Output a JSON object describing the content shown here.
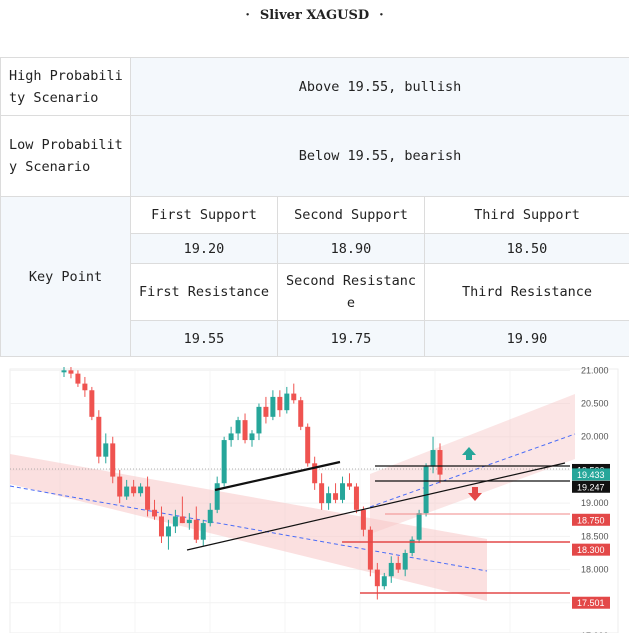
{
  "title": {
    "dot_left": "·",
    "text": "Sliver XAGUSD",
    "dot_right": "·"
  },
  "table": {
    "high_label": "High Probability Scenario",
    "high_value": "Above 19.55, bullish",
    "low_label": "Low Probability Scenario",
    "low_value": "Below 19.55, bearish",
    "key_point_label": "Key Point",
    "first_support": "First Support",
    "second_support": "Second Support",
    "third_support": "Third Support",
    "first_support_value": "19.20",
    "second_support_value": "18.90",
    "third_support_value": "18.50",
    "first_resistance": "First Resistance",
    "second_resistance": "Second Resistance",
    "third_resistance": "Third Resistance",
    "first_resistance_value": "19.55",
    "second_resistance_value": "19.75",
    "third_resistance_value": "19.90"
  },
  "chart_data": {
    "type": "candlestick",
    "y_ticks": [
      "21.000",
      "20.500",
      "20.000",
      "19.500",
      "19.000",
      "18.500",
      "18.000",
      "17.000"
    ],
    "ylim": [
      16.97,
      21.02
    ],
    "price_labels": [
      {
        "text": "19.500",
        "value": 19.5,
        "color": "#111111"
      },
      {
        "text": "19.433",
        "value": 19.433,
        "color": "#26a69a"
      },
      {
        "text": "19.247",
        "value": 19.247,
        "color": "#111111"
      },
      {
        "text": "18.750",
        "value": 18.75,
        "color": "#e34848"
      },
      {
        "text": "18.300",
        "value": 18.3,
        "color": "#e34848"
      },
      {
        "text": "17.501",
        "value": 17.501,
        "color": "#e34848"
      }
    ],
    "up_color": "#26a69a",
    "down_color": "#ef5350",
    "candles": [
      {
        "o": 20.97,
        "h": 21.05,
        "l": 20.9,
        "c": 21.0
      },
      {
        "o": 21.0,
        "h": 21.05,
        "l": 20.88,
        "c": 20.95
      },
      {
        "o": 20.95,
        "h": 21.0,
        "l": 20.75,
        "c": 20.8
      },
      {
        "o": 20.8,
        "h": 20.9,
        "l": 20.6,
        "c": 20.7
      },
      {
        "o": 20.7,
        "h": 20.75,
        "l": 20.25,
        "c": 20.3
      },
      {
        "o": 20.3,
        "h": 20.4,
        "l": 19.6,
        "c": 19.7
      },
      {
        "o": 19.7,
        "h": 20.05,
        "l": 19.6,
        "c": 19.9
      },
      {
        "o": 19.9,
        "h": 20.0,
        "l": 19.3,
        "c": 19.4
      },
      {
        "o": 19.4,
        "h": 19.5,
        "l": 19.0,
        "c": 19.1
      },
      {
        "o": 19.1,
        "h": 19.35,
        "l": 19.05,
        "c": 19.25
      },
      {
        "o": 19.25,
        "h": 19.35,
        "l": 19.1,
        "c": 19.15
      },
      {
        "o": 19.15,
        "h": 19.3,
        "l": 19.1,
        "c": 19.25
      },
      {
        "o": 19.25,
        "h": 19.4,
        "l": 18.8,
        "c": 18.9
      },
      {
        "o": 18.9,
        "h": 19.05,
        "l": 18.75,
        "c": 18.8
      },
      {
        "o": 18.8,
        "h": 18.95,
        "l": 18.4,
        "c": 18.5
      },
      {
        "o": 18.5,
        "h": 18.75,
        "l": 18.3,
        "c": 18.65
      },
      {
        "o": 18.65,
        "h": 18.9,
        "l": 18.55,
        "c": 18.8
      },
      {
        "o": 18.8,
        "h": 19.1,
        "l": 18.7,
        "c": 18.7
      },
      {
        "o": 18.7,
        "h": 18.85,
        "l": 18.6,
        "c": 18.75
      },
      {
        "o": 18.75,
        "h": 18.95,
        "l": 18.4,
        "c": 18.45
      },
      {
        "o": 18.45,
        "h": 18.75,
        "l": 18.35,
        "c": 18.7
      },
      {
        "o": 18.7,
        "h": 19.0,
        "l": 18.65,
        "c": 18.9
      },
      {
        "o": 18.9,
        "h": 19.4,
        "l": 18.85,
        "c": 19.3
      },
      {
        "o": 19.3,
        "h": 20.0,
        "l": 19.25,
        "c": 19.95
      },
      {
        "o": 19.95,
        "h": 20.15,
        "l": 19.85,
        "c": 20.05
      },
      {
        "o": 20.05,
        "h": 20.3,
        "l": 19.95,
        "c": 20.25
      },
      {
        "o": 20.25,
        "h": 20.35,
        "l": 19.9,
        "c": 19.95
      },
      {
        "o": 19.95,
        "h": 20.1,
        "l": 19.85,
        "c": 20.05
      },
      {
        "o": 20.05,
        "h": 20.5,
        "l": 19.95,
        "c": 20.45
      },
      {
        "o": 20.45,
        "h": 20.6,
        "l": 20.2,
        "c": 20.3
      },
      {
        "o": 20.3,
        "h": 20.7,
        "l": 20.25,
        "c": 20.6
      },
      {
        "o": 20.6,
        "h": 20.7,
        "l": 20.3,
        "c": 20.4
      },
      {
        "o": 20.4,
        "h": 20.75,
        "l": 20.35,
        "c": 20.65
      },
      {
        "o": 20.65,
        "h": 20.8,
        "l": 20.5,
        "c": 20.55
      },
      {
        "o": 20.55,
        "h": 20.6,
        "l": 20.1,
        "c": 20.15
      },
      {
        "o": 20.15,
        "h": 20.2,
        "l": 19.55,
        "c": 19.6
      },
      {
        "o": 19.6,
        "h": 19.7,
        "l": 19.2,
        "c": 19.3
      },
      {
        "o": 19.3,
        "h": 19.45,
        "l": 18.9,
        "c": 19.0
      },
      {
        "o": 19.0,
        "h": 19.25,
        "l": 18.9,
        "c": 19.15
      },
      {
        "o": 19.15,
        "h": 19.3,
        "l": 19.0,
        "c": 19.05
      },
      {
        "o": 19.05,
        "h": 19.4,
        "l": 19.0,
        "c": 19.3
      },
      {
        "o": 19.3,
        "h": 19.45,
        "l": 19.2,
        "c": 19.25
      },
      {
        "o": 19.25,
        "h": 19.3,
        "l": 18.85,
        "c": 18.9
      },
      {
        "o": 18.9,
        "h": 18.95,
        "l": 18.5,
        "c": 18.6
      },
      {
        "o": 18.6,
        "h": 18.65,
        "l": 17.9,
        "c": 18.0
      },
      {
        "o": 18.0,
        "h": 18.1,
        "l": 17.55,
        "c": 17.75
      },
      {
        "o": 17.75,
        "h": 17.95,
        "l": 17.7,
        "c": 17.9
      },
      {
        "o": 17.9,
        "h": 18.2,
        "l": 17.8,
        "c": 18.1
      },
      {
        "o": 18.1,
        "h": 18.2,
        "l": 17.95,
        "c": 18.0
      },
      {
        "o": 18.0,
        "h": 18.3,
        "l": 17.9,
        "c": 18.25
      },
      {
        "o": 18.25,
        "h": 18.5,
        "l": 18.2,
        "c": 18.45
      },
      {
        "o": 18.45,
        "h": 18.9,
        "l": 18.4,
        "c": 18.85
      },
      {
        "o": 18.85,
        "h": 19.6,
        "l": 18.8,
        "c": 19.55
      },
      {
        "o": 19.55,
        "h": 20.0,
        "l": 19.45,
        "c": 19.8
      },
      {
        "o": 19.8,
        "h": 19.9,
        "l": 19.3,
        "c": 19.43
      }
    ]
  }
}
